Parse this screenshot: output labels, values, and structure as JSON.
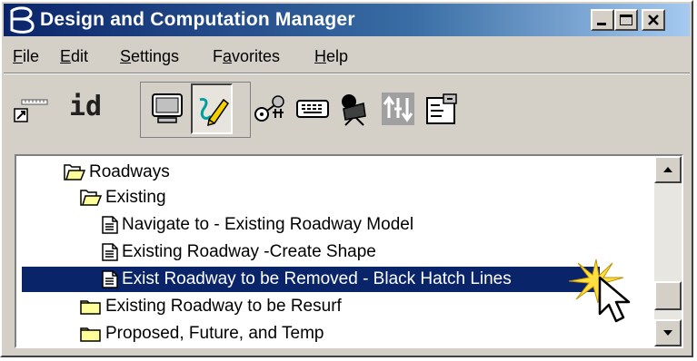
{
  "window": {
    "title": "Design and Computation Manager",
    "controls": [
      "minimize",
      "maximize",
      "close"
    ]
  },
  "menu": [
    {
      "label": "File",
      "key": "F",
      "rest": "ile"
    },
    {
      "label": "Edit",
      "key": "E",
      "rest": "dit"
    },
    {
      "label": "Settings",
      "key": "S",
      "rest": "ettings"
    },
    {
      "label": "Favorites",
      "pre": "F",
      "key": "a",
      "rest": "vorites"
    },
    {
      "label": "Help",
      "key": "H",
      "rest": "elp"
    }
  ],
  "toolbar": {
    "id_label": "id",
    "tools": [
      "dimension-shortcut",
      "id",
      "monitor",
      "draw-pen",
      "key-person",
      "keypad",
      "projector",
      "sort-arrows",
      "properties"
    ]
  },
  "tree": {
    "items": [
      {
        "label": "Roadways",
        "type": "folder-open",
        "level": 1
      },
      {
        "label": "Existing",
        "type": "folder-open",
        "level": 2
      },
      {
        "label": "Navigate to - Existing Roadway Model",
        "type": "document",
        "level": 3
      },
      {
        "label": "Existing Roadway -Create Shape",
        "type": "document",
        "level": 3
      },
      {
        "label": "Exist Roadway to be Removed - Black Hatch Lines",
        "type": "document",
        "level": 3,
        "selected": true
      },
      {
        "label": "Existing Roadway to be Resurf",
        "type": "folder",
        "level": 2
      },
      {
        "label": "Proposed, Future, and Temp",
        "type": "folder",
        "level": 2
      }
    ]
  },
  "colors": {
    "title_start": "#0a246a",
    "title_end": "#a6caf0",
    "selection": "#0a246a",
    "folder": "#ffff99"
  }
}
